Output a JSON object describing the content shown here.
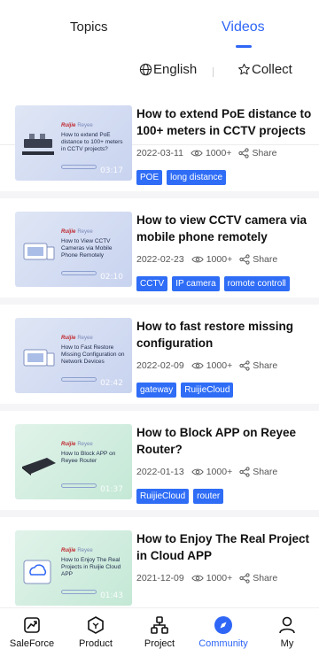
{
  "tabs": {
    "topics": "Topics",
    "videos": "Videos"
  },
  "filters": {
    "language": "English",
    "collect": "Collect"
  },
  "videos": [
    {
      "thumb_brand": "Ruijie",
      "thumb_sub": "Reyee",
      "thumb_title": "How to extend PoE distance to 100+ meters in CCTV projects?",
      "duration": "03:17",
      "title": "How to extend PoE distance to 100+ meters in CCTV projects",
      "date": "2022-03-11",
      "views": "1000+",
      "share": "Share",
      "tags": [
        "POE",
        "long distance"
      ]
    },
    {
      "thumb_brand": "Ruijie",
      "thumb_sub": "Reyee",
      "thumb_title": "How to View CCTV Cameras via Mobile Phone Remotely",
      "duration": "02:10",
      "title": "How to view CCTV camera via mobile phone remotely",
      "date": "2022-02-23",
      "views": "1000+",
      "share": "Share",
      "tags": [
        "CCTV",
        "IP camera",
        "romote controll"
      ]
    },
    {
      "thumb_brand": "Ruijie",
      "thumb_sub": "Reyee",
      "thumb_title": "How to Fast Restore Missing Configuration on Network Devices",
      "duration": "02:42",
      "title": "How to fast restore missing configuration",
      "date": "2022-02-09",
      "views": "1000+",
      "share": "Share",
      "tags": [
        "gateway",
        "RuijieCloud"
      ]
    },
    {
      "thumb_brand": "Ruijie",
      "thumb_sub": "Reyee",
      "thumb_title": "How to Block APP on Reyee Router",
      "duration": "01:37",
      "title": "How to Block APP on Reyee Router?",
      "date": "2022-01-13",
      "views": "1000+",
      "share": "Share",
      "tags": [
        "RuijieCloud",
        "router"
      ]
    },
    {
      "thumb_brand": "Ruijie",
      "thumb_sub": "Reyee",
      "thumb_title": "How to Enjoy The Real Projects in Ruijie Cloud APP",
      "duration": "01:43",
      "title": "How to Enjoy The Real Project in Cloud APP",
      "date": "2021-12-09",
      "views": "1000+",
      "share": "Share",
      "tags": []
    }
  ],
  "nav": [
    {
      "label": "SaleForce",
      "icon": "chart-icon"
    },
    {
      "label": "Product",
      "icon": "product-icon"
    },
    {
      "label": "Project",
      "icon": "project-icon"
    },
    {
      "label": "Community",
      "icon": "compass-icon",
      "active": true
    },
    {
      "label": "My",
      "icon": "user-icon"
    }
  ],
  "colors": {
    "accent": "#2f66f6",
    "tag_bg": "#2f6df6"
  }
}
